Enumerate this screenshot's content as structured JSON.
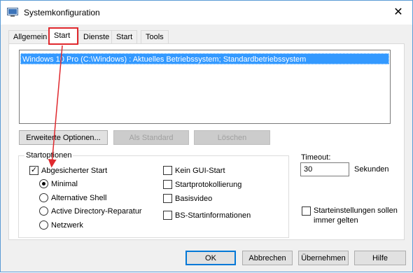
{
  "window": {
    "title": "Systemkonfiguration",
    "close_glyph": "✕"
  },
  "tabs": [
    {
      "label": "Allgemein"
    },
    {
      "label": "Start",
      "highlighted": true
    },
    {
      "label": "Dienste"
    },
    {
      "label": "Start"
    },
    {
      "label": "Tools"
    }
  ],
  "os_list": {
    "items": [
      "Windows 10 Pro (C:\\Windows) : Aktuelles Betriebssystem; Standardbetriebssystem"
    ],
    "selected_index": 0
  },
  "buttons": {
    "advanced": "Erweiterte Optionen...",
    "set_default": "Als Standard",
    "delete": "Löschen"
  },
  "start_options": {
    "label": "Startoptionen",
    "safe_boot": {
      "label": "Abgesicherter Start",
      "checked": true
    },
    "minimal": {
      "label": "Minimal",
      "selected": true
    },
    "alternate_shell": {
      "label": "Alternative Shell",
      "selected": false
    },
    "ad_repair": {
      "label": "Active Directory-Reparatur",
      "selected": false
    },
    "network": {
      "label": "Netzwerk",
      "selected": false
    },
    "no_gui": {
      "label": "Kein GUI-Start",
      "checked": false
    },
    "boot_log": {
      "label": "Startprotokollierung",
      "checked": false
    },
    "base_video": {
      "label": "Basisvideo",
      "checked": false
    },
    "os_boot_info": {
      "label": "BS-Startinformationen",
      "checked": false
    }
  },
  "timeout": {
    "label": "Timeout:",
    "value": "30",
    "unit": "Sekunden"
  },
  "persist": {
    "label_line1": "Starteinstellungen sollen",
    "label_line2": "immer gelten",
    "checked": false
  },
  "footer": {
    "ok": "OK",
    "cancel": "Abbrechen",
    "apply": "Übernehmen",
    "help": "Hilfe"
  },
  "colors": {
    "highlight": "#e0292e",
    "selection": "#3399ff",
    "default_button": "#0078d7"
  },
  "check_glyph": "✓",
  "icons": {
    "app": "msconfig-icon",
    "close": "close-icon"
  }
}
